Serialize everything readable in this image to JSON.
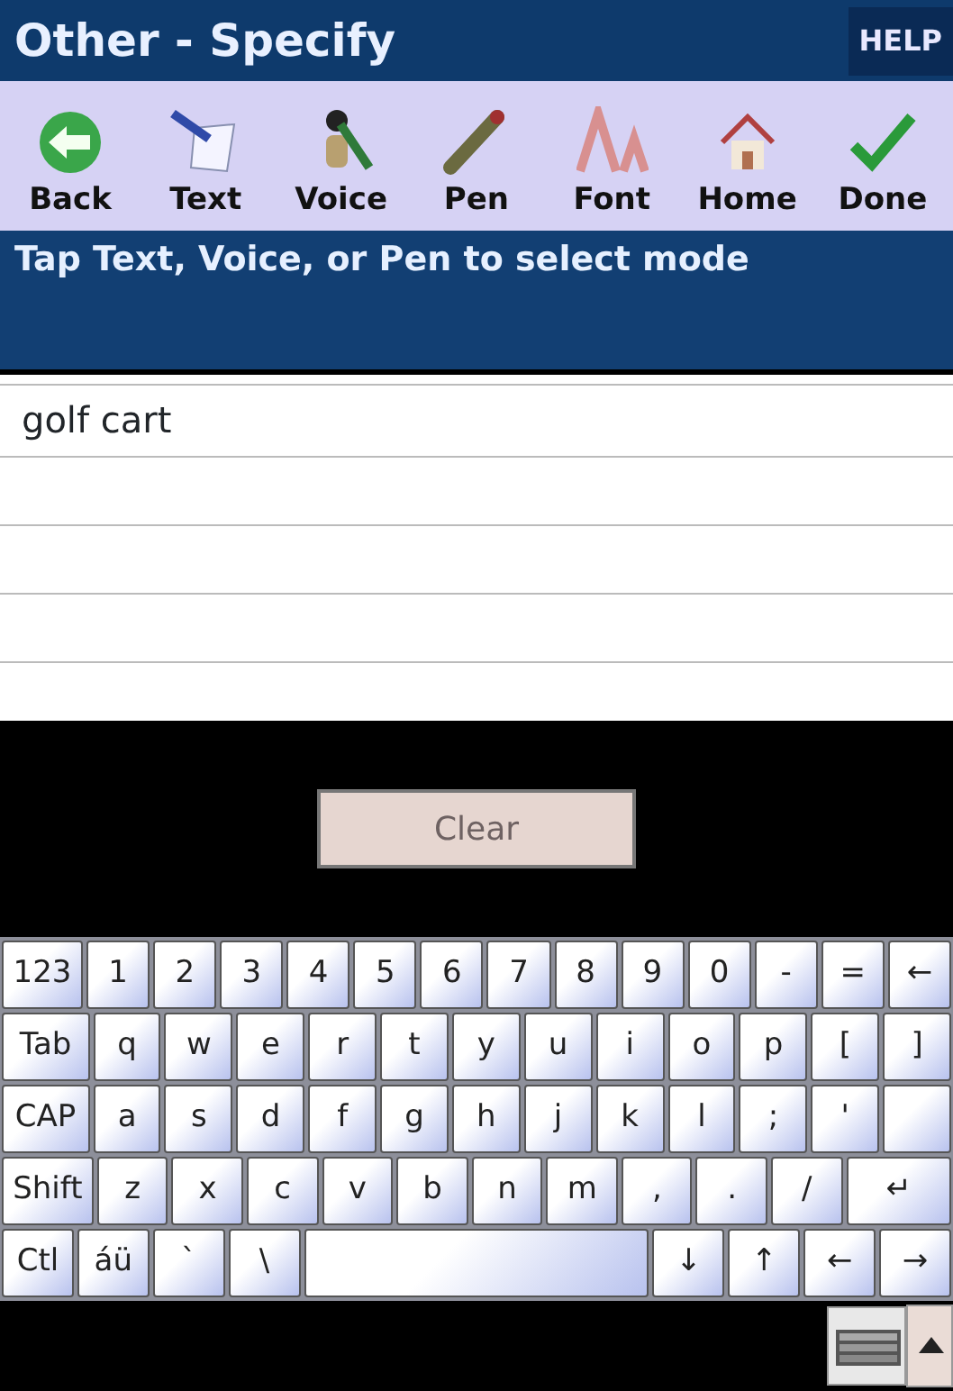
{
  "title_bar": {
    "title": "Other - Specify",
    "help": "HELP"
  },
  "toolbar": [
    {
      "kind": "back",
      "label": "Back"
    },
    {
      "kind": "text",
      "label": "Text"
    },
    {
      "kind": "voice",
      "label": "Voice"
    },
    {
      "kind": "pen",
      "label": "Pen"
    },
    {
      "kind": "font",
      "label": "Font"
    },
    {
      "kind": "home",
      "label": "Home"
    },
    {
      "kind": "done",
      "label": "Done"
    }
  ],
  "instruction": "Tap Text, Voice, or Pen to select mode",
  "text_area": {
    "value": "golf cart"
  },
  "clear_button": {
    "label": "Clear",
    "disabled": true
  },
  "keyboard": {
    "rows": [
      {
        "keys": [
          {
            "kind": "wide",
            "label": "123"
          },
          {
            "kind": "key",
            "label": "1"
          },
          {
            "kind": "key",
            "label": "2"
          },
          {
            "kind": "key",
            "label": "3"
          },
          {
            "kind": "key",
            "label": "4"
          },
          {
            "kind": "key",
            "label": "5"
          },
          {
            "kind": "key",
            "label": "6"
          },
          {
            "kind": "key",
            "label": "7"
          },
          {
            "kind": "key",
            "label": "8"
          },
          {
            "kind": "key",
            "label": "9"
          },
          {
            "kind": "key",
            "label": "0"
          },
          {
            "kind": "key",
            "label": "-"
          },
          {
            "kind": "key",
            "label": "="
          },
          {
            "kind": "key",
            "label": "←"
          }
        ]
      },
      {
        "keys": [
          {
            "kind": "wide",
            "label": "Tab"
          },
          {
            "kind": "key",
            "label": "q"
          },
          {
            "kind": "key",
            "label": "w"
          },
          {
            "kind": "key",
            "label": "e"
          },
          {
            "kind": "key",
            "label": "r"
          },
          {
            "kind": "key",
            "label": "t"
          },
          {
            "kind": "key",
            "label": "y"
          },
          {
            "kind": "key",
            "label": "u"
          },
          {
            "kind": "key",
            "label": "i"
          },
          {
            "kind": "key",
            "label": "o"
          },
          {
            "kind": "key",
            "label": "p"
          },
          {
            "kind": "key",
            "label": "["
          },
          {
            "kind": "key",
            "label": "]"
          }
        ]
      },
      {
        "keys": [
          {
            "kind": "wide",
            "label": "CAP"
          },
          {
            "kind": "key",
            "label": "a"
          },
          {
            "kind": "key",
            "label": "s"
          },
          {
            "kind": "key",
            "label": "d"
          },
          {
            "kind": "key",
            "label": "f"
          },
          {
            "kind": "key",
            "label": "g"
          },
          {
            "kind": "key",
            "label": "h"
          },
          {
            "kind": "key",
            "label": "j"
          },
          {
            "kind": "key",
            "label": "k"
          },
          {
            "kind": "key",
            "label": "l"
          },
          {
            "kind": "key",
            "label": ";"
          },
          {
            "kind": "key",
            "label": "'"
          },
          {
            "kind": "enter-top"
          }
        ]
      },
      {
        "keys": [
          {
            "kind": "wide",
            "label": "Shift"
          },
          {
            "kind": "key",
            "label": "z"
          },
          {
            "kind": "key",
            "label": "x"
          },
          {
            "kind": "key",
            "label": "c"
          },
          {
            "kind": "key",
            "label": "v"
          },
          {
            "kind": "key",
            "label": "b"
          },
          {
            "kind": "key",
            "label": "n"
          },
          {
            "kind": "key",
            "label": "m"
          },
          {
            "kind": "key",
            "label": ","
          },
          {
            "kind": "key",
            "label": "."
          },
          {
            "kind": "key",
            "label": "/"
          },
          {
            "kind": "enter",
            "label": "↵"
          }
        ]
      },
      {
        "keys": [
          {
            "kind": "key",
            "label": "Ctl"
          },
          {
            "kind": "key",
            "label": "áü"
          },
          {
            "kind": "key",
            "label": "`"
          },
          {
            "kind": "key",
            "label": "\\"
          },
          {
            "kind": "space"
          },
          {
            "kind": "key",
            "label": "↓"
          },
          {
            "kind": "key",
            "label": "↑"
          },
          {
            "kind": "key",
            "label": "←"
          },
          {
            "kind": "key",
            "label": "→"
          }
        ]
      }
    ]
  }
}
